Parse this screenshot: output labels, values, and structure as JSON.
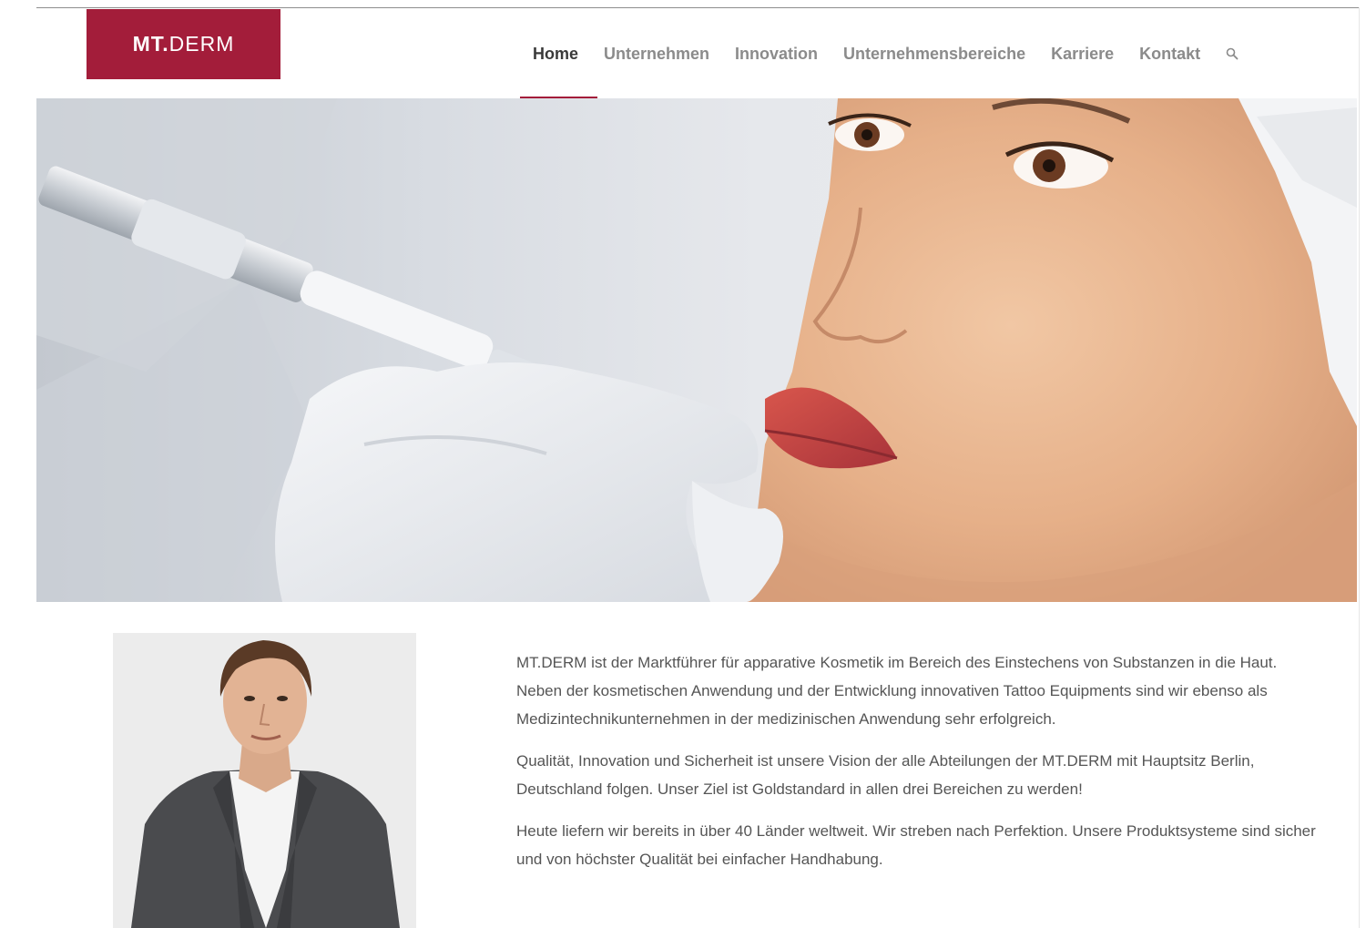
{
  "header": {
    "logo": {
      "text_bold": "MT.",
      "text_light": "DERM",
      "background_color": "#a31d3a"
    },
    "nav": {
      "items": [
        {
          "label": "Home",
          "active": true
        },
        {
          "label": "Unternehmen",
          "active": false
        },
        {
          "label": "Innovation",
          "active": false
        },
        {
          "label": "Unternehmensbereiche",
          "active": false
        },
        {
          "label": "Karriere",
          "active": false
        },
        {
          "label": "Kontakt",
          "active": false
        }
      ],
      "search_icon": "search-icon",
      "accent_color": "#a31d3a"
    }
  },
  "hero": {
    "image": "permanent-makeup-lip-treatment-photo"
  },
  "main": {
    "portrait": "man-in-grey-blazer-portrait",
    "paragraphs": [
      "MT.DERM ist der Marktführer für apparative Kosmetik im Bereich des Einstechens von Substanzen in die Haut. Neben der kosmetischen Anwendung und der Entwicklung innovativen Tattoo Equipments sind wir ebenso als Medizintechnikunternehmen in der medizinischen Anwendung sehr erfolgreich.",
      "Qualität, Innovation und Sicherheit ist unsere Vision der alle Abteilungen der MT.DERM mit Hauptsitz Berlin, Deutschland folgen. Unser Ziel ist Goldstandard in allen drei Bereichen zu werden!",
      "Heute liefern wir bereits in über 40 Länder weltweit. Wir streben nach Perfektion. Unsere Produktsysteme sind sicher und von höchster Qualität bei einfacher Handhabung."
    ]
  }
}
